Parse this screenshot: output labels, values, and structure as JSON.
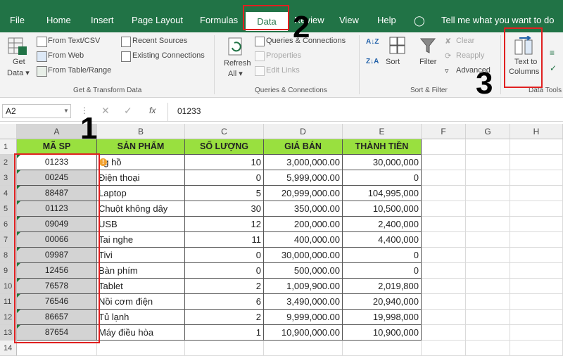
{
  "menu": {
    "items": [
      "File",
      "Home",
      "Insert",
      "Page Layout",
      "Formulas",
      "Data",
      "Review",
      "View",
      "Help"
    ],
    "tell_me": "Tell me what you want to do"
  },
  "ribbon": {
    "get_data": {
      "line1": "Get",
      "line2": "Data ▾"
    },
    "get_transform": {
      "from_text_csv": "From Text/CSV",
      "from_web": "From Web",
      "from_table_range": "From Table/Range",
      "recent_sources": "Recent Sources",
      "existing_connections": "Existing Connections",
      "group_label": "Get & Transform Data"
    },
    "queries": {
      "refresh_line1": "Refresh",
      "refresh_line2": "All ▾",
      "queries_connections": "Queries & Connections",
      "properties": "Properties",
      "edit_links": "Edit Links",
      "group_label": "Queries & Connections"
    },
    "sort_filter": {
      "sort": "Sort",
      "filter": "Filter",
      "clear": "Clear",
      "reapply": "Reapply",
      "advanced": "Advanced",
      "az": "A↓Z",
      "za": "Z↓A",
      "group_label": "Sort & Filter"
    },
    "data_tools": {
      "text_to_columns_line1": "Text to",
      "text_to_columns_line2": "Columns",
      "group_label": "Data Tools"
    }
  },
  "formula_bar": {
    "name_box": "A2",
    "fx": "fx",
    "value": "01233"
  },
  "columns": [
    "A",
    "B",
    "C",
    "D",
    "E",
    "F",
    "G",
    "H"
  ],
  "headers": [
    "MÃ SP",
    "SẢN PHẨM",
    "SỐ LƯỢNG",
    "GIÁ BÁN",
    "THÀNH TIỀN"
  ],
  "rows": [
    {
      "num": "1"
    },
    {
      "num": "2",
      "code": "01233",
      "product": "ng hồ",
      "qty": "10",
      "price": "3,000,000.00",
      "total": "30,000,000"
    },
    {
      "num": "3",
      "code": "00245",
      "product": "Điện thoại",
      "qty": "0",
      "price": "5,999,000.00",
      "total": "0"
    },
    {
      "num": "4",
      "code": "88487",
      "product": "Laptop",
      "qty": "5",
      "price": "20,999,000.00",
      "total": "104,995,000"
    },
    {
      "num": "5",
      "code": "01123",
      "product": "Chuột không dây",
      "qty": "30",
      "price": "350,000.00",
      "total": "10,500,000"
    },
    {
      "num": "6",
      "code": "09049",
      "product": "USB",
      "qty": "12",
      "price": "200,000.00",
      "total": "2,400,000"
    },
    {
      "num": "7",
      "code": "00066",
      "product": "Tai nghe",
      "qty": "11",
      "price": "400,000.00",
      "total": "4,400,000"
    },
    {
      "num": "8",
      "code": "09987",
      "product": "Tivi",
      "qty": "0",
      "price": "30,000,000.00",
      "total": "0"
    },
    {
      "num": "9",
      "code": "12456",
      "product": "Bàn phím",
      "qty": "0",
      "price": "500,000.00",
      "total": "0"
    },
    {
      "num": "10",
      "code": "76578",
      "product": "Tablet",
      "qty": "2",
      "price": "1,009,900.00",
      "total": "2,019,800"
    },
    {
      "num": "11",
      "code": "76546",
      "product": "Nồi cơm điện",
      "qty": "6",
      "price": "3,490,000.00",
      "total": "20,940,000"
    },
    {
      "num": "12",
      "code": "86657",
      "product": "Tủ lạnh",
      "qty": "2",
      "price": "9,999,000.00",
      "total": "19,998,000"
    },
    {
      "num": "13",
      "code": "87654",
      "product": "Máy điều hòa",
      "qty": "1",
      "price": "10,900,000.00",
      "total": "10,900,000"
    },
    {
      "num": "14"
    }
  ],
  "callouts": {
    "one": "1",
    "two": "2",
    "three": "3"
  },
  "colors": {
    "excel_green": "#217346",
    "header_fill": "#99e03f",
    "highlight_red": "#e02020",
    "selection_gray": "#d3d3d3"
  }
}
